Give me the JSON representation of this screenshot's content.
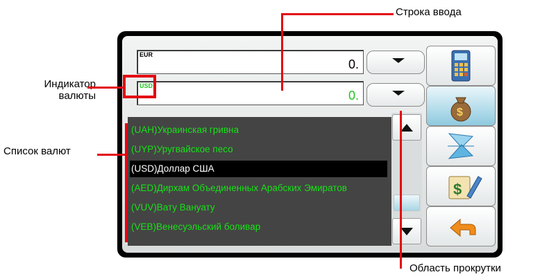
{
  "callouts": {
    "input_line": "Строка ввода",
    "currency_indicator": "Индикатор\nвалюты",
    "currency_list": "Список валют",
    "scroll_area": "Область прокрутки"
  },
  "fields": [
    {
      "code": "EUR",
      "value": "0.",
      "code_color": "#000000",
      "value_color": "#000000"
    },
    {
      "code": "USD",
      "value": "0.",
      "code_color": "#22c322",
      "value_color": "#22c322"
    }
  ],
  "currency_list": [
    {
      "label": "(UAH)Украинская гривна",
      "selected": false
    },
    {
      "label": "(UYP)Уругвайское песо",
      "selected": false
    },
    {
      "label": "(USD)Доллар США",
      "selected": true
    },
    {
      "label": "(AED)Дирхам  Объединенных Арабских  Эмиратов",
      "selected": false
    },
    {
      "label": "(VUV)Вату Вануату",
      "selected": false
    },
    {
      "label": "(VEB)Венесуэльский боливар",
      "selected": false
    }
  ],
  "toolbar_icons": [
    "calculator-icon",
    "money-bag-icon",
    "reflection-icon",
    "currency-edit-icon",
    "back-arrow-icon"
  ],
  "colors": {
    "callout_red": "#e30613",
    "list_green": "#18e018",
    "list_bg": "#444444"
  }
}
